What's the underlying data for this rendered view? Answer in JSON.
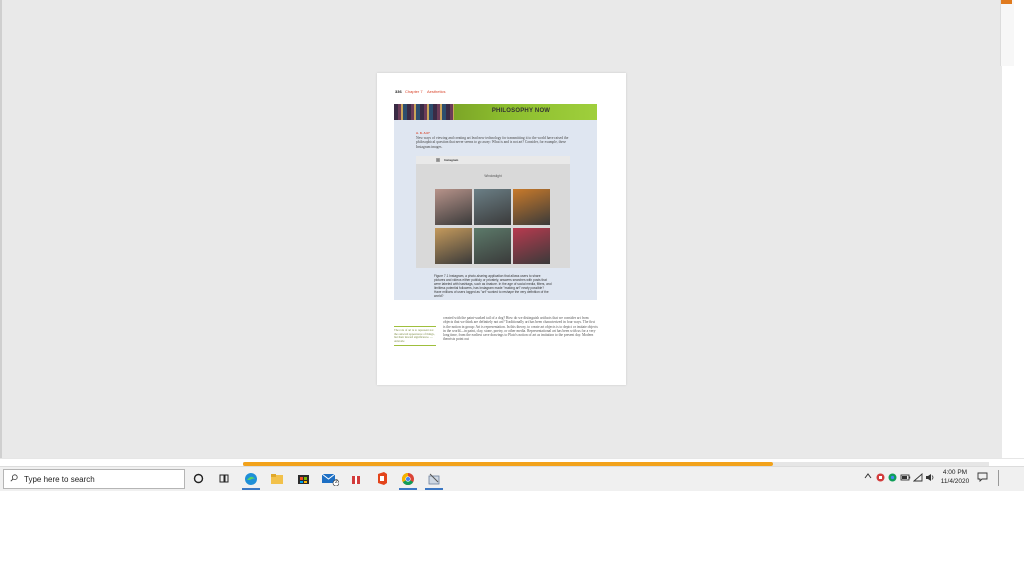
{
  "document": {
    "page_number": "336",
    "chapter": "Chapter 7",
    "section": "Aesthetics",
    "box_title": "PHILOSOPHY NOW",
    "box_label": "A. K. Art?",
    "box_text": "New ways of viewing and creating art lead new technology for transmitting it to the world have raised the philosophical question that never seems to go away: What is and is not art? Consider, for example, these Instagram images.",
    "screen_brand": "Instagram",
    "screen_user": "Windowlight",
    "figure_caption": "Figure 7.1 Instagram, a photo-sharing application that allows users to share pictures and videos either publicly or privately, answers searches with posts that were labeled with hashtags, such as #nature. In the age of social media, filters, and limitless potential followers, has Instagram made \"making art\" newly possible? Have millions of users logged as \"art\" worked to reshape the very definition of the world?",
    "margin_note": "The role of art is to represent not the outward appearance of things, but their inward significance. — Aristotle",
    "body_text": "created with the paint-soaked tail of a dog? How do we distinguish artifacts that we consider art from objects that we think are definitely not art? Traditionally art has been characterized in four ways. The first is the notion in group: Art is representation. In this theory, to create art objects is to depict or imitate objects in the world—in paint, clay, stone, poetry, or other media. Representational art has been with us for a very long time, from the earliest cave drawings to Plato's notion of art as imitation to the present day. Modern theorists point out"
  },
  "photos": [
    {
      "name": "photo-backpack",
      "color": "#b7938a"
    },
    {
      "name": "photo-stairs",
      "color": "#6b7f86"
    },
    {
      "name": "photo-sunset-couple",
      "color": "#c97a2a"
    },
    {
      "name": "photo-dog",
      "color": "#c59a5c"
    },
    {
      "name": "photo-green-bird",
      "color": "#5c7a6a"
    },
    {
      "name": "photo-red-legs",
      "color": "#b83a4f"
    }
  ],
  "taskbar": {
    "search_placeholder": "Type here to search",
    "mail_badge": "2",
    "clock_time": "4:00 PM",
    "clock_date": "11/4/2020"
  },
  "colors": {
    "accent_orange": "#f2a21b",
    "taskbar_bg": "#f0f0f0",
    "active_indicator": "#3b77c4"
  },
  "scroll": {
    "horizontal_position_fraction": 0.71
  }
}
